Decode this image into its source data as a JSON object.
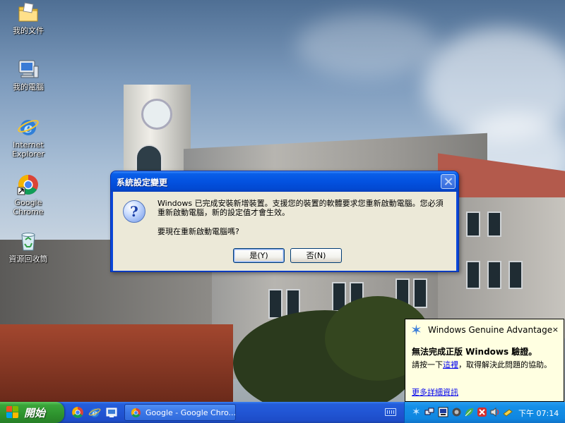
{
  "desktop": {
    "icons": [
      {
        "label": "我的文件"
      },
      {
        "label": "我的電腦"
      },
      {
        "label": "Internet\nExplorer"
      },
      {
        "label": "Google\nChrome"
      },
      {
        "label": "資源回收筒"
      }
    ]
  },
  "dialog": {
    "title": "系統設定變更",
    "message": "Windows 已完成安裝新增裝置。支援您的裝置的軟體要求您重新啟動電腦。您必須重新啟動電腦，新的設定值才會生效。",
    "question": "要現在重新啟動電腦嗎?",
    "yes_label": "是(Y)",
    "no_label": "否(N)",
    "icon": "question-icon"
  },
  "balloon": {
    "title": "Windows Genuine Advantage",
    "close_glyph": "×",
    "heading": "無法完成正版 Windows 驗證。",
    "text_before": "請按一下",
    "link_text": "這裡",
    "text_after": "，取得解決此問題的協助。",
    "more_link": "更多詳細資訊"
  },
  "taskbar": {
    "start_label": "開始",
    "quick_launch": [
      "chrome-icon",
      "ie-icon",
      "show-desktop-icon"
    ],
    "tasks": [
      {
        "label": "Google - Google Chro..."
      }
    ],
    "clock": "下午 07:14"
  },
  "colors": {
    "taskbar_blue": "#245edb",
    "start_green": "#3aa53a",
    "dialog_face": "#ece9d8",
    "balloon_bg": "#ffffe1"
  }
}
